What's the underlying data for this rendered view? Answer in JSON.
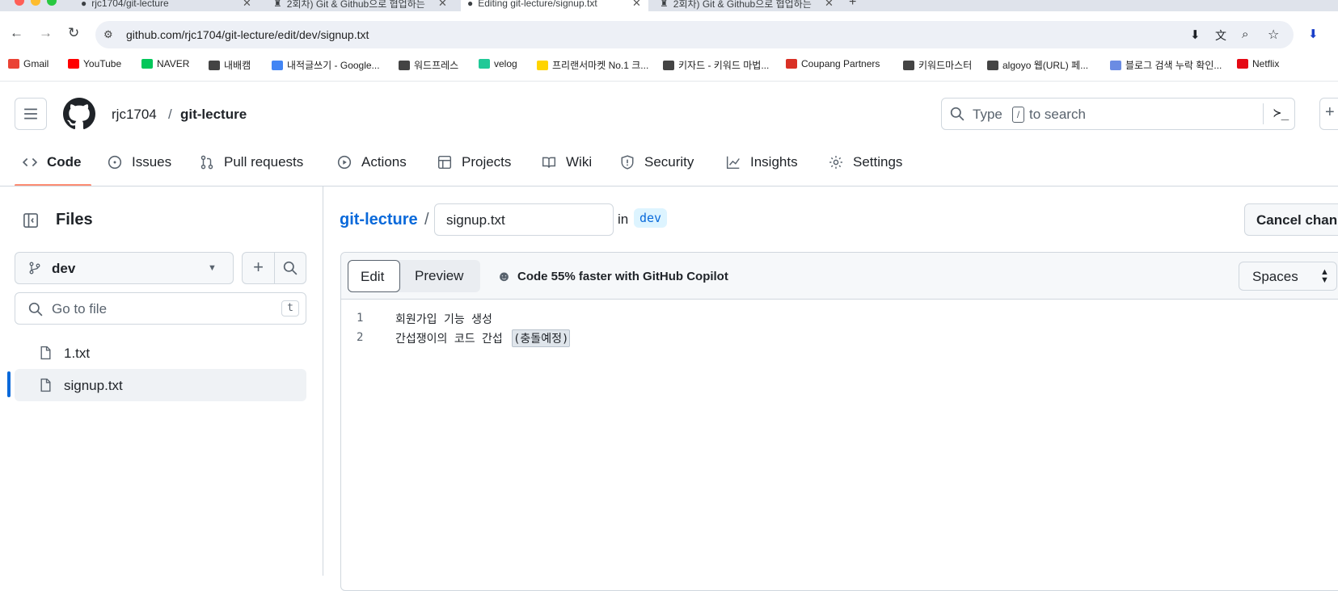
{
  "browser": {
    "tabs": [
      {
        "title": "rjc1704/git-lecture"
      },
      {
        "title": "2회차) Git & Github으로 협업하는"
      },
      {
        "title": "Editing git-lecture/signup.txt"
      },
      {
        "title": "2회차) Git & Github으로 협업하는"
      }
    ],
    "url": "github.com/rjc1704/git-lecture/edit/dev/signup.txt",
    "bookmarks": [
      {
        "label": "Gmail",
        "icon": "gmail-icon",
        "color": "#ea4335"
      },
      {
        "label": "YouTube",
        "icon": "youtube-icon",
        "color": "#ff0000"
      },
      {
        "label": "NAVER",
        "icon": "naver-icon",
        "color": "#03c75a"
      },
      {
        "label": "내배캠",
        "icon": "folder-icon",
        "color": "#444"
      },
      {
        "label": "내적글쓰기 - Google...",
        "icon": "docs-icon",
        "color": "#4285f4"
      },
      {
        "label": "워드프레스",
        "icon": "folder-icon",
        "color": "#444"
      },
      {
        "label": "velog",
        "icon": "velog-icon",
        "color": "#20c997"
      },
      {
        "label": "프리랜서마켓 No.1 크...",
        "icon": "kmong-icon",
        "color": "#ffd400"
      },
      {
        "label": "키자드 - 키워드 마법...",
        "icon": "wand-icon",
        "color": "#444"
      },
      {
        "label": "Coupang Partners",
        "icon": "coupang-icon",
        "color": "#d93025"
      },
      {
        "label": "키워드마스터",
        "icon": "globe-icon",
        "color": "#444"
      },
      {
        "label": "algoyo 웹(URL) 페...",
        "icon": "globe-icon",
        "color": "#444"
      },
      {
        "label": "블로그 검색 누락 확인...",
        "icon": "blog-icon",
        "color": "#6b8ce3"
      },
      {
        "label": "Netflix",
        "icon": "netflix-icon",
        "color": "#e50914"
      }
    ]
  },
  "header": {
    "owner": "rjc1704",
    "separator": "/",
    "repo": "git-lecture",
    "search_placeholder_pre": "Type",
    "search_key": "/",
    "search_placeholder_post": "to search"
  },
  "nav": {
    "tabs": [
      {
        "label": "Code",
        "icon": "code-icon"
      },
      {
        "label": "Issues",
        "icon": "issue-icon"
      },
      {
        "label": "Pull requests",
        "icon": "pull-request-icon"
      },
      {
        "label": "Actions",
        "icon": "play-icon"
      },
      {
        "label": "Projects",
        "icon": "table-icon"
      },
      {
        "label": "Wiki",
        "icon": "book-icon"
      },
      {
        "label": "Security",
        "icon": "shield-icon"
      },
      {
        "label": "Insights",
        "icon": "graph-icon"
      },
      {
        "label": "Settings",
        "icon": "gear-icon"
      }
    ]
  },
  "sidebar": {
    "title": "Files",
    "branch": "dev",
    "goto_placeholder": "Go to file",
    "goto_shortcut": "t",
    "files": [
      {
        "name": "1.txt",
        "selected": false
      },
      {
        "name": "signup.txt",
        "selected": true
      }
    ]
  },
  "editor": {
    "breadcrumb_repo": "git-lecture",
    "breadcrumb_sep": "/",
    "filename": "signup.txt",
    "in_label": "in",
    "branch": "dev",
    "cancel_label": "Cancel chan",
    "edit_tab": "Edit",
    "preview_tab": "Preview",
    "copilot_text": "Code 55% faster with GitHub Copilot",
    "indent_mode": "Spaces",
    "lines": [
      {
        "num": "1",
        "text": "회원가입 기능 생성"
      },
      {
        "num": "2",
        "text": "간섭쟁이의 코드 간섭 ",
        "highlight": "(충돌예정)"
      }
    ]
  },
  "colors": {
    "accent_blue": "#0969da",
    "code_underline": "#fd8c73",
    "selected_bar": "#0969da"
  }
}
